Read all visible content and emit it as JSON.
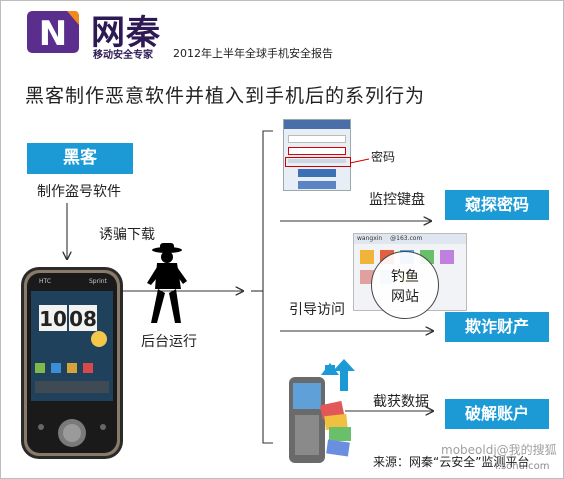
{
  "brand": {
    "logo_letter": "N",
    "name": "网秦",
    "slogan": "移动安全专家",
    "report_title": "2012年上半年全球手机安全报告"
  },
  "main_title": "黑客制作恶意软件并植入到手机后的系列行为",
  "left_flow": {
    "hacker_label": "黑客",
    "make_software": "制作盗号软件",
    "deceive_download": "诱骗下载",
    "background_run": "后台运行"
  },
  "phone": {
    "carrier": "Sprint",
    "clock": "10:08",
    "brand": "HTC"
  },
  "login_screen": {
    "password_note": "密码"
  },
  "behaviors": [
    {
      "action": "监控键盘",
      "result": "窥探密码"
    },
    {
      "action": "引导访问",
      "result": "欺诈财产"
    },
    {
      "action": "截获数据",
      "result": "破解账户"
    }
  ],
  "phishing_bubble": {
    "line1": "钓鱼",
    "line2": "网站"
  },
  "email_screen": {
    "user": "wangxin",
    "domain": "@163.com"
  },
  "source": "来源：网秦“云安全”监测平台",
  "watermark": {
    "text": "mobeoldj@我的搜狐",
    "site": "i.sohu.com"
  },
  "colors": {
    "accent": "#1b9ad6",
    "logo_purple": "#5b2d8c",
    "logo_orange": "#f08a1c"
  }
}
